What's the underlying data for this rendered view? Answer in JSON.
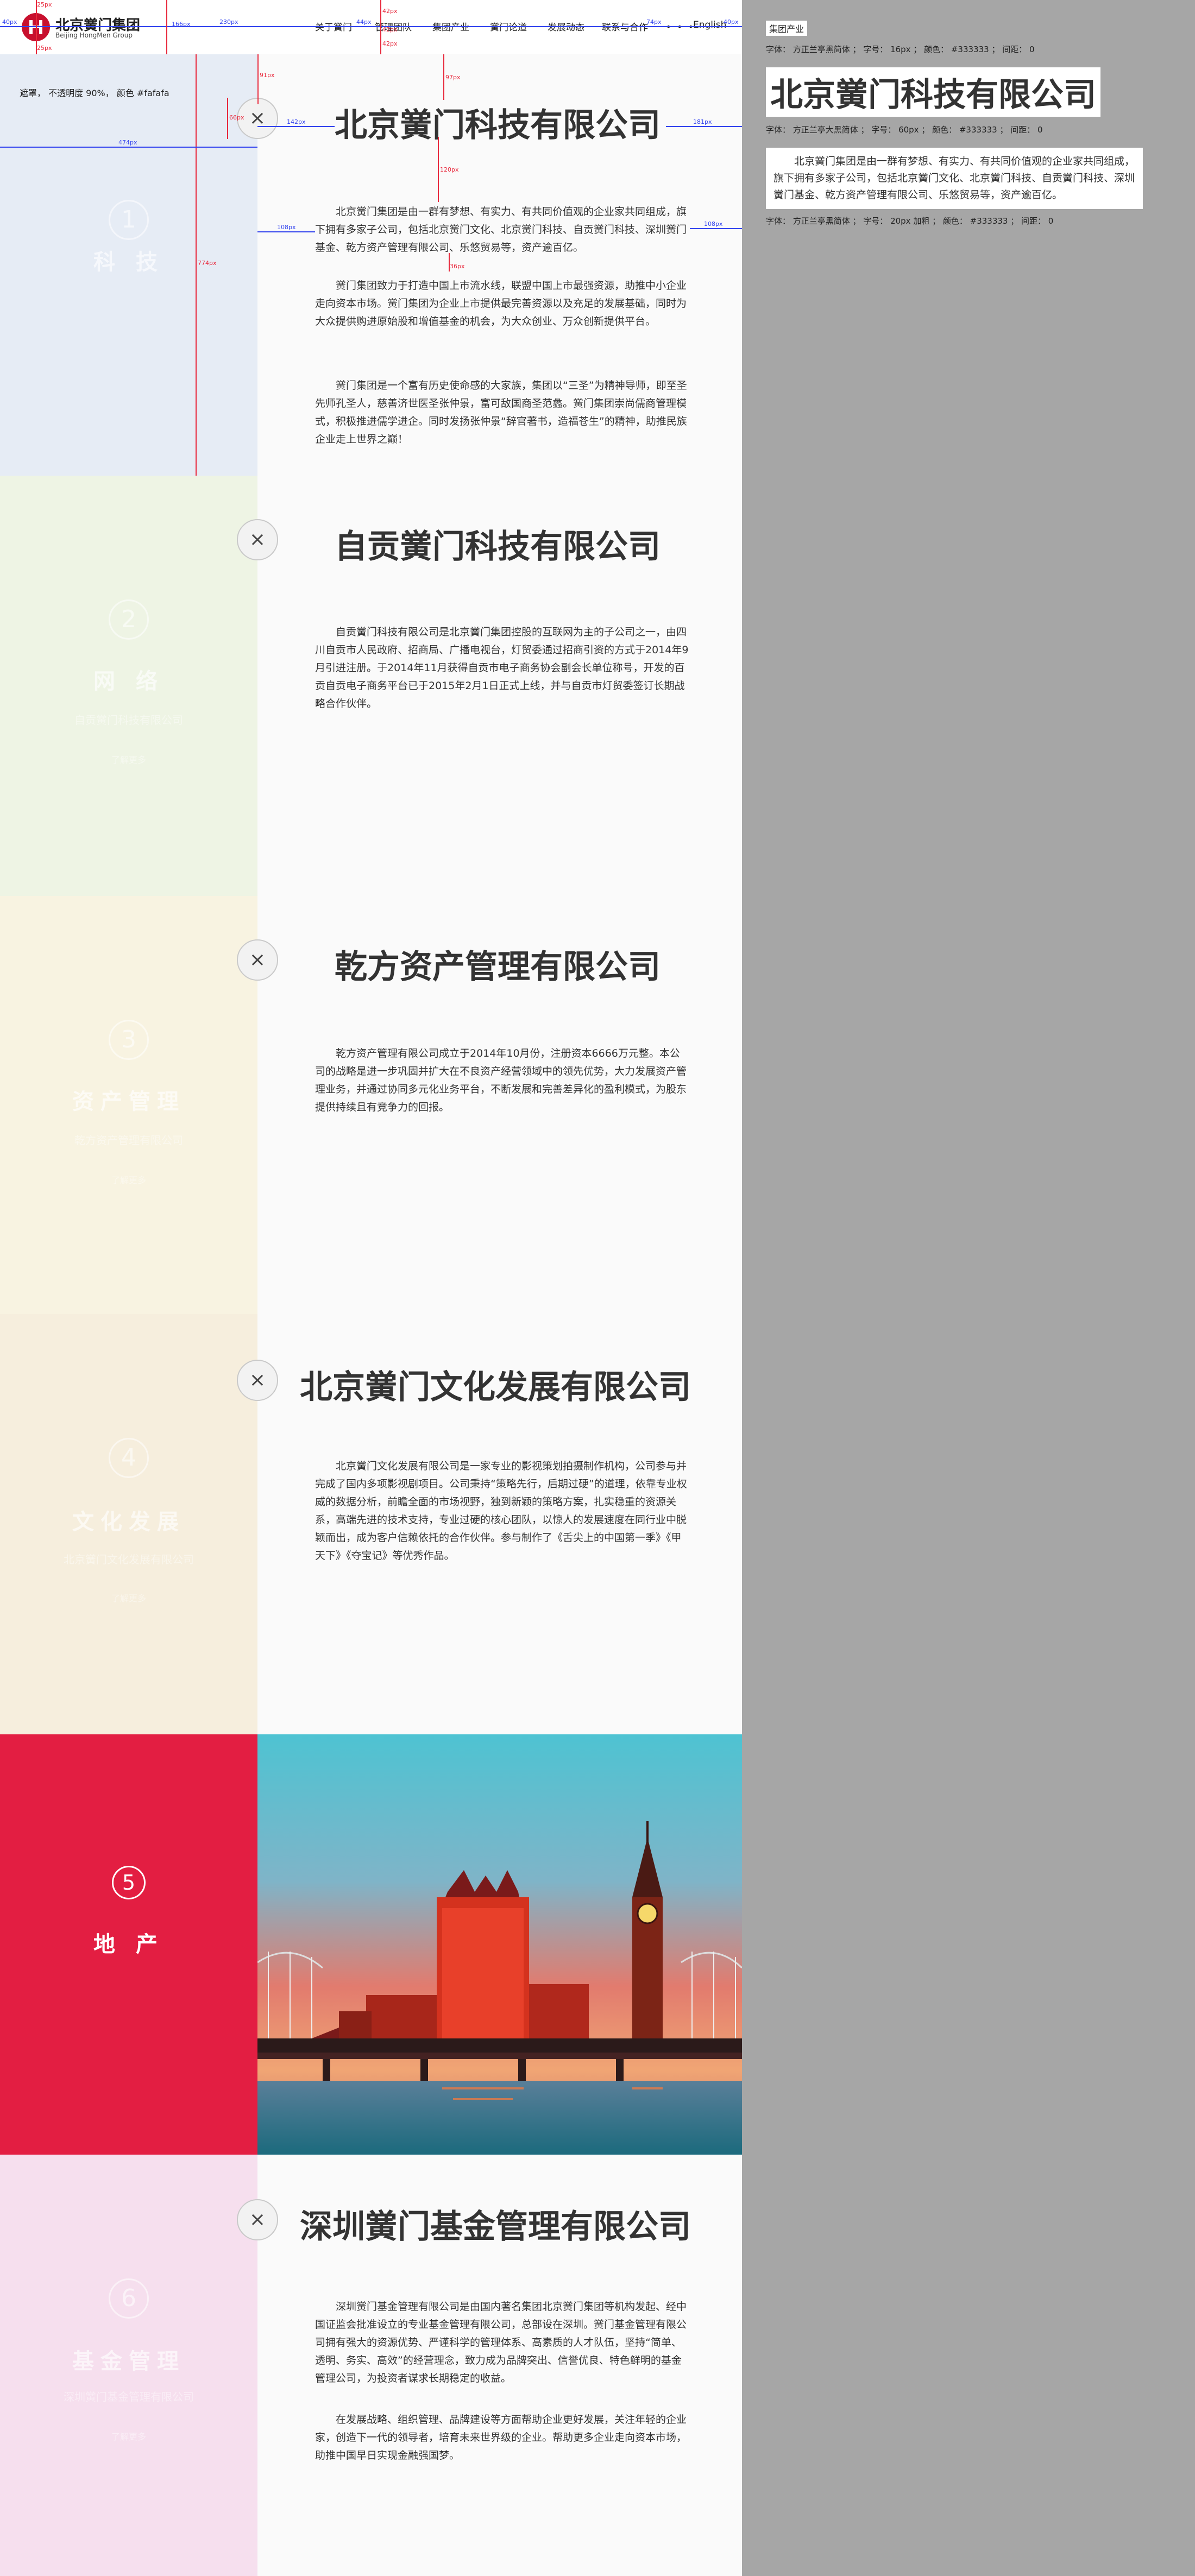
{
  "header": {
    "logo_glyph": "",
    "logo_cn": "北京黉门集团",
    "logo_en": "Beijing HongMen Group",
    "nav": [
      "关于黉门",
      "管理团队",
      "集团产业",
      "黉门论道",
      "发展动态",
      "联系与合作"
    ],
    "dots": "• • •",
    "language": "English"
  },
  "annotations": {
    "h40": "40px",
    "h44": "44px",
    "h40b": "40px",
    "h74": "74px",
    "h230": "230px",
    "h166": "166px",
    "v25": "25px",
    "v25b": "25px",
    "v42": "42px",
    "v42b": "42px",
    "v42c": "42px",
    "v91": "91px",
    "v97": "97px",
    "v120": "120px",
    "v36": "36px",
    "v66": "66px",
    "v774": "774px",
    "w474": "474px",
    "w142": "142px",
    "w181": "181px",
    "w108": "108px",
    "w108b": "108px",
    "mask_note": "遮罩， 不透明度 90%， 颜色 #fafafa"
  },
  "sidebar": [
    {
      "num": "1",
      "title": "科 技",
      "sub": "",
      "mini": "",
      "color": "#e6ecf5"
    },
    {
      "num": "2",
      "title": "网 络",
      "sub": "自贡黉门科技有限公司",
      "mini": "了解更多",
      "color": "#eef4e4"
    },
    {
      "num": "3",
      "title": "资产管理",
      "sub": "乾方资产管理有限公司",
      "mini": "了解更多",
      "color": "#f8f3e1"
    },
    {
      "num": "4",
      "title": "文化发展",
      "sub": "北京黉门文化发展有限公司",
      "mini": "了解更多",
      "color": "#f6eedd"
    },
    {
      "num": "5",
      "title": "地 产",
      "sub": "",
      "mini": "",
      "color": "#e31e42"
    },
    {
      "num": "6",
      "title": "基金管理",
      "sub": "深圳黉门基金管理有限公司",
      "mini": "了解更多",
      "color": "#f6dfee"
    }
  ],
  "content": {
    "close_glyph": "×",
    "c1_title": "北京黉门科技有限公司",
    "c1_p1": "北京黉门集团是由一群有梦想、有实力、有共同价值观的企业家共同组成，旗下拥有多家子公司，包括北京黉门文化、北京黉门科技、自贡黉门科技、深圳黉门基金、乾方资产管理有限公司、乐悠贸易等，资产逾百亿。",
    "c1_p2": "黉门集团致力于打造中国上市流水线，联盟中国上市最强资源，助推中小企业走向资本市场。黉门集团为企业上市提供最完善资源以及充足的发展基础，同时为大众提供购进原始股和增值基金的机会，为大众创业、万众创新提供平台。",
    "c1_p3": "黉门集团是一个富有历史使命感的大家族，集团以“三圣”为精神导师，即至圣先师孔圣人，慈善济世医圣张仲景，富可敌国商圣范蠡。黉门集团崇尚儒商管理模式，积极推进儒学进企。同时发扬张仲景“辞官著书，造福苍生”的精神，助推民族企业走上世界之巅！",
    "c2_title": "自贡黉门科技有限公司",
    "c2_p1": "自贡黉门科技有限公司是北京黉门集团控股的互联网为主的子公司之一，由四川自贡市人民政府、招商局、广播电视台，灯贸委通过招商引资的方式于2014年9月引进注册。于2014年11月获得自贡市电子商务协会副会长单位称号，开发的百贡自贡电子商务平台已于2015年2月1日正式上线，并与自贡市灯贸委签订长期战略合作伙伴。",
    "c3_title": "乾方资产管理有限公司",
    "c3_p1": "乾方资产管理有限公司成立于2014年10月份，注册资本6666万元整。本公司的战略是进一步巩固并扩大在不良资产经营领域中的领先优势，大力发展资产管理业务，并通过协同多元化业务平台，不断发展和完善差异化的盈利模式，为股东提供持续且有竞争力的回报。",
    "c4_title": "北京黉门文化发展有限公司",
    "c4_p1": "北京黉门文化发展有限公司是一家专业的影视策划拍摄制作机构，公司参与并完成了国内多项影视剧项目。公司秉持“策略先行，后期过硬”的道理，依靠专业权威的数据分析，前瞻全面的市场视野，独到新颖的策略方案，扎实稳重的资源关系，高端先进的技术支持，专业过硬的核心团队，以惊人的发展速度在同行业中脱颖而出，成为客户信赖依托的合作伙伴。参与制作了《舌尖上的中国第一季》《甲天下》《夺宝记》等优秀作品。",
    "c6_title": "深圳黉门基金管理有限公司",
    "c6_p1": "深圳黉门基金管理有限公司是由国内著名集团北京黉门集团等机构发起、经中国证监会批准设立的专业基金管理有限公司，总部设在深圳。黉门基金管理有限公司拥有强大的资源优势、严谨科学的管理体系、高素质的人才队伍，坚持“简单、透明、务实、高效”的经营理念，致力成为品牌突出、信誉优良、特色鲜明的基金管理公司，为投资者谋求长期稳定的收益。",
    "c6_p2": "在发展战略、组织管理、品牌建设等方面帮助企业更好发展，关注年轻的企业家，创造下一代的领导者，培育未来世界级的企业。帮助更多企业走向资本市场，助推中国早日实现金融强国梦。"
  },
  "spec_panel": {
    "tag": "集团产业",
    "spec1": "字体： 方正兰亭黑简体 ； 字号： 16px ； 颜色： #333333 ； 间距： 0",
    "big_title": "北京黉门科技有限公司",
    "spec2": "字体： 方正兰亭大黑简体 ； 字号： 60px ； 颜色： #333333 ； 间距： 0",
    "para": "北京黉门集团是由一群有梦想、有实力、有共同价值观的企业家共同组成，旗下拥有多家子公司，包括北京黉门文化、北京黉门科技、自贡黉门科技、深圳黉门基金、乾方资产管理有限公司、乐悠贸易等，资产逾百亿。",
    "spec3": "字体： 方正兰亭黑简体 ； 字号： 20px 加粗 ； 颜色： #333333 ； 间距： 0"
  },
  "colors": {
    "brand": "#c8102e",
    "guide_blue": "#3344ee",
    "guide_red": "#e8283c",
    "panel": "#a6a6a6"
  }
}
